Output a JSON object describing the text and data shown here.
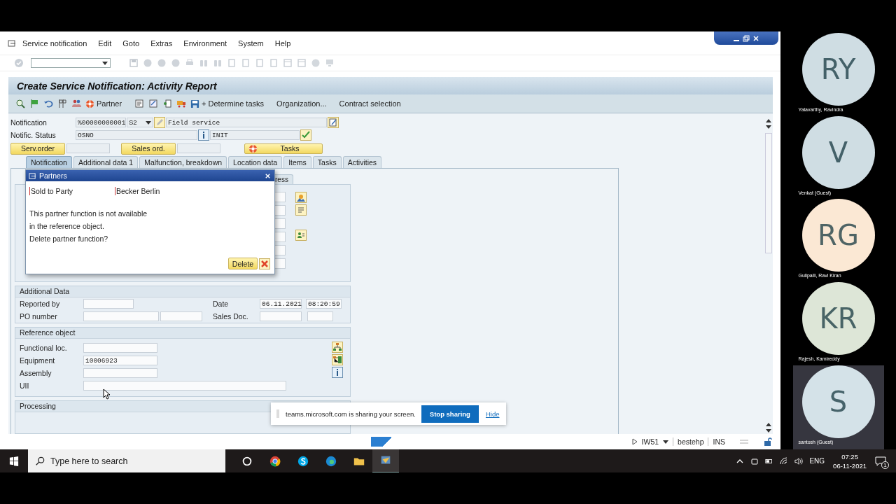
{
  "menu": [
    "Service notification",
    "Edit",
    "Goto",
    "Extras",
    "Environment",
    "System",
    "Help"
  ],
  "title": "Create Service Notification: Activity Report",
  "app_toolbar": [
    {
      "kind": "partner",
      "label": "Partner"
    },
    {
      "kind": "save",
      "label": "+ Determine tasks"
    },
    {
      "kind": "text",
      "label": "Organization..."
    },
    {
      "kind": "text",
      "label": "Contract selection"
    }
  ],
  "header": {
    "notification_label": "Notification",
    "notification": "%00000000001",
    "type": "S2",
    "description": "Field service",
    "status_label": "Notific. Status",
    "status": "OSNO",
    "status_text": "INIT"
  },
  "buttons": [
    {
      "kind": "plain",
      "label": "Serv.order"
    },
    {
      "kind": "plain",
      "label": "Sales ord."
    },
    {
      "kind": "tasks",
      "label": "Tasks"
    }
  ],
  "tabs": [
    {
      "label": "Notification",
      "selected": true
    },
    {
      "label": "Additional data 1",
      "selected": false
    },
    {
      "label": "Malfunction, breakdown",
      "selected": false
    },
    {
      "label": "Location data",
      "selected": false
    },
    {
      "label": "Items",
      "selected": false
    },
    {
      "label": "Tasks",
      "selected": false
    },
    {
      "label": "Activities",
      "selected": false
    }
  ],
  "sub_tab": "ress",
  "additional_data": {
    "title": "Additional Data",
    "reported_by_label": "Reported by",
    "date_label": "Date",
    "date": "06.11.2021",
    "time": "08:20:59",
    "po_number_label": "PO number",
    "sales_doc_label": "Sales Doc."
  },
  "reference_object": {
    "title": "Reference object",
    "rows": [
      {
        "kind": "short",
        "label": "Functional loc."
      },
      {
        "kind": "short",
        "label": "Equipment",
        "value": "10006923"
      },
      {
        "kind": "short",
        "label": "Assembly"
      },
      {
        "kind": "long",
        "label": "UII"
      }
    ]
  },
  "processing_title": "Processing",
  "dialog": {
    "title": "Partners",
    "function": "Sold to Party",
    "partner": "Becker Berlin",
    "message_lines": [
      "This partner function is not available",
      "in the reference object.",
      "Delete partner function?"
    ],
    "confirm": "Delete"
  },
  "status_bar": {
    "transaction": "IW51",
    "server": "bestehp",
    "mode": "INS"
  },
  "share_bar": {
    "text": "teams.microsoft.com is sharing your screen.",
    "stop": "Stop sharing",
    "hide": "Hide"
  },
  "taskbar": {
    "search_placeholder": "Type here to search",
    "language": "ENG",
    "time": "07:25",
    "date": "06-11-2021",
    "notifications": "1"
  },
  "participants": [
    {
      "initials": "RY",
      "name": "Yalavarthy, Ravindra",
      "color": "#cfdde3",
      "speaking": false
    },
    {
      "initials": "V",
      "name": "Venkat (Guest)",
      "color": "#cfdde3",
      "speaking": false
    },
    {
      "initials": "RG",
      "name": "Gulipalli, Ravi Kiran",
      "color": "#fbe8d4",
      "speaking": false
    },
    {
      "initials": "KR",
      "name": "Rajesh, Kamireddy",
      "color": "#dde6d7",
      "speaking": false
    },
    {
      "initials": "S",
      "name": "santosh (Guest)",
      "color": "#d4e2e8",
      "speaking": true
    }
  ]
}
